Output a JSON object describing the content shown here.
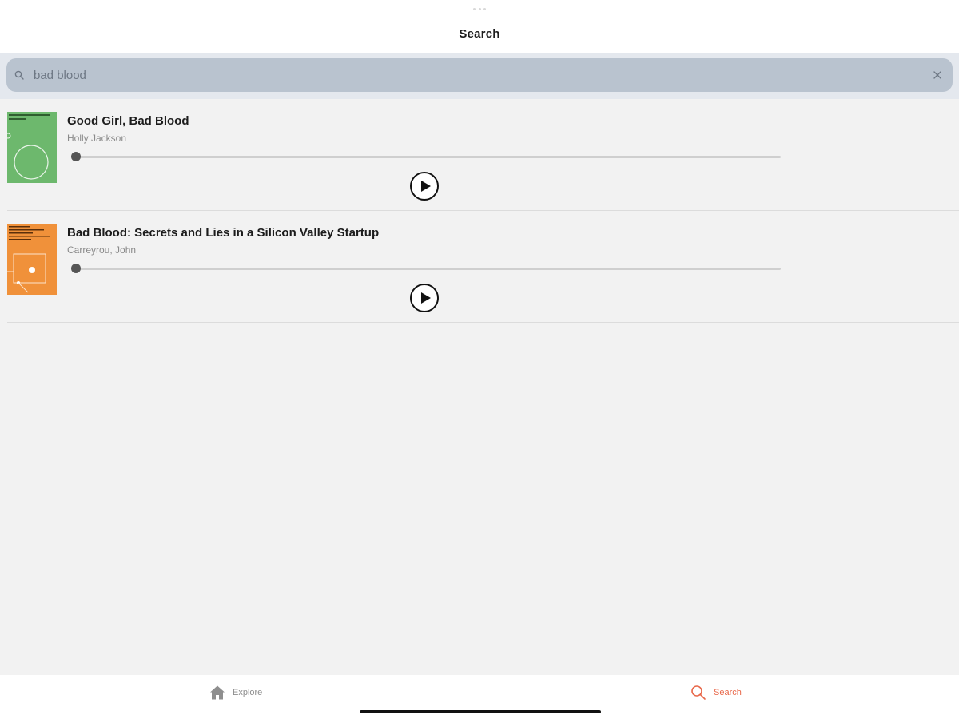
{
  "header": {
    "title": "Search"
  },
  "search": {
    "value": "bad blood",
    "icon": "search-icon",
    "clear_icon": "close-icon"
  },
  "results": [
    {
      "title": "Good Girl, Bad Blood",
      "author": "Holly Jackson",
      "progress": 0,
      "cover_color": "#6db86d",
      "play_icon": "play-icon"
    },
    {
      "title": "Bad Blood: Secrets and Lies in a Silicon Valley Startup",
      "author": "Carreyrou, John",
      "progress": 0,
      "cover_color": "#f0913a",
      "play_icon": "play-icon"
    }
  ],
  "tabs": [
    {
      "label": "Explore",
      "icon": "home-icon",
      "active": false
    },
    {
      "label": "Search",
      "icon": "search-icon",
      "active": true
    }
  ],
  "colors": {
    "accent": "#e8684a",
    "search_field": "#b9c3cf",
    "background": "#f2f2f2"
  }
}
